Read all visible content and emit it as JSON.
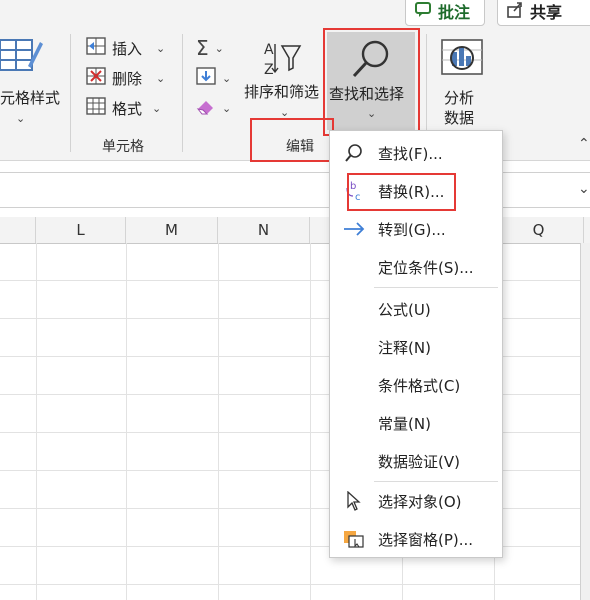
{
  "topbar": {
    "comment_label": "批注",
    "share_label": "共享"
  },
  "ribbon": {
    "cell_styles_label": "元格样式",
    "insert_label": "插入",
    "delete_label": "删除",
    "format_label": "格式",
    "cells_group_label": "单元格",
    "sort_filter_label": "排序和筛选",
    "find_select_label": "查找和选择",
    "editing_group_label": "编辑",
    "analyze_label_line1": "分析",
    "analyze_label_line2": "数据"
  },
  "columns": [
    "L",
    "M",
    "N",
    "Q"
  ],
  "menu": {
    "items": [
      {
        "label": "查找(F)..."
      },
      {
        "label": "替换(R)..."
      },
      {
        "label": "转到(G)..."
      },
      {
        "label": "定位条件(S)..."
      },
      {
        "label": "公式(U)"
      },
      {
        "label": "注释(N)"
      },
      {
        "label": "条件格式(C)"
      },
      {
        "label": "常量(N)"
      },
      {
        "label": "数据验证(V)"
      },
      {
        "label": "选择对象(O)"
      },
      {
        "label": "选择窗格(P)..."
      }
    ]
  },
  "colors": {
    "highlight_red": "#e53935",
    "accent_green": "#2e7d32",
    "selected_button_bg": "#d0d0d0"
  }
}
